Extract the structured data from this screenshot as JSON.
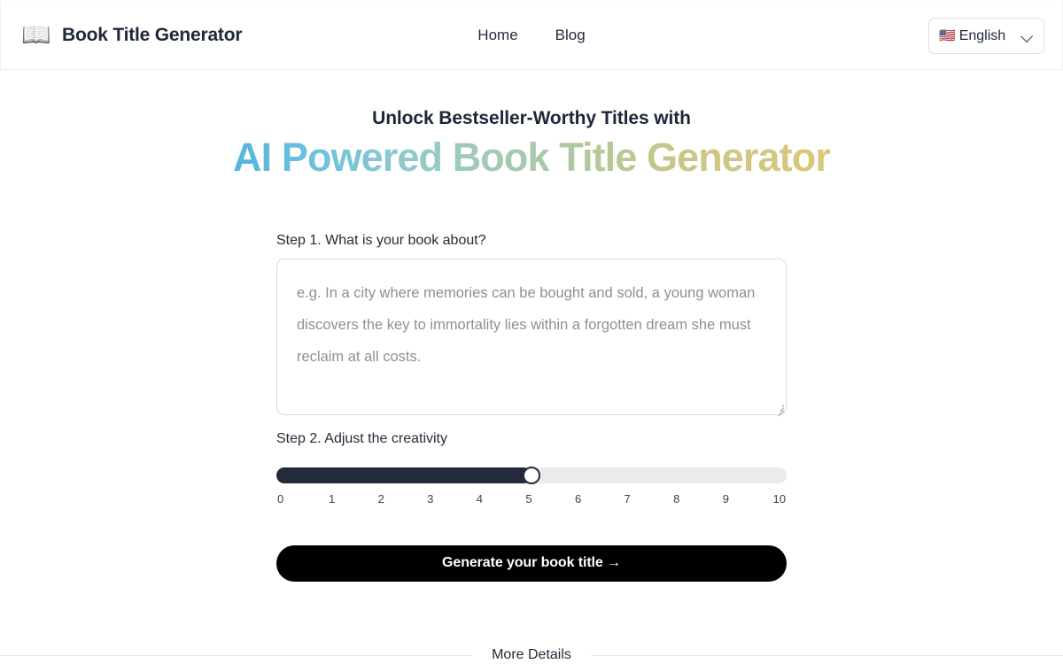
{
  "header": {
    "brand": {
      "logo_icon": "open-book-sparkles-emoji",
      "logo_glyph": "📖",
      "title": "Book Title Generator"
    },
    "nav": [
      {
        "label": "Home"
      },
      {
        "label": "Blog"
      }
    ],
    "language_selector": {
      "flag_icon": "us-flag-emoji",
      "flag_glyph": "🇺🇸",
      "selected": "English",
      "chevron_icon": "chevron-down-icon"
    }
  },
  "hero": {
    "subtitle": "Unlock Bestseller-Worthy Titles with",
    "title": "AI Powered Book Title Generator",
    "gradient_start": "#55b4e0",
    "gradient_mid": "#a9c9a4",
    "gradient_end": "#d9c878"
  },
  "form": {
    "step1_label": "Step 1. What is your book about?",
    "prompt_value": "",
    "prompt_placeholder": "e.g. In a city where memories can be bought and sold, a young woman discovers the key to immortality lies within a forgotten dream she must reclaim at all costs.",
    "step2_label": "Step 2. Adjust the creativity",
    "slider": {
      "value": 5,
      "min": 0,
      "max": 10,
      "ticks": [
        "0",
        "1",
        "2",
        "3",
        "4",
        "5",
        "6",
        "7",
        "8",
        "9",
        "10"
      ],
      "fill_color": "#232b3a",
      "track_color": "#e9ebec"
    },
    "submit_label": "Generate your book title →"
  },
  "footer": {
    "more_details_label": "More Details"
  }
}
